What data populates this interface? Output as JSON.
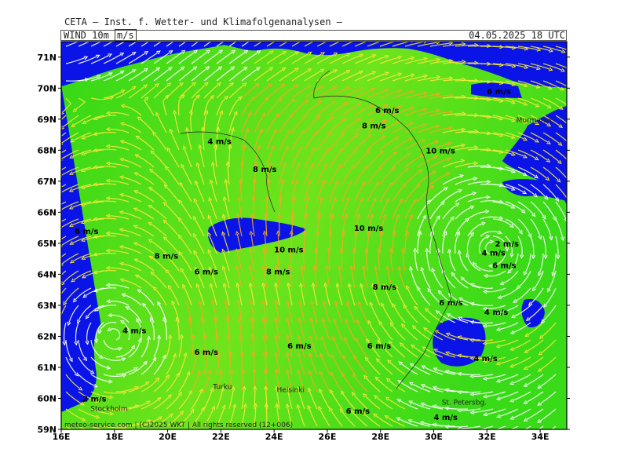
{
  "header": {
    "title": "CETA — Inst. f. Wetter- und Klimafolgenanalysen —",
    "parameter": "WIND  10m",
    "unit": "m/s",
    "datetime": "04.05.2025  18 UTC"
  },
  "map": {
    "lon_range": [
      16,
      35
    ],
    "lat_range": [
      59,
      71.5
    ],
    "lat_ticks": [
      "71N",
      "70N",
      "69N",
      "68N",
      "67N",
      "66N",
      "65N",
      "64N",
      "63N",
      "62N",
      "61N",
      "60N",
      "59N"
    ],
    "lon_ticks": [
      "16E",
      "18E",
      "20E",
      "22E",
      "24E",
      "26E",
      "28E",
      "30E",
      "32E",
      "34E"
    ],
    "colors": {
      "sea": "#0a14e6",
      "land_low": "#35dc1a",
      "land_high": "#7ee81e",
      "stream_calm": "#ffffff",
      "stream_mid": "#f7e93a",
      "stream_strong": "#f4a820"
    },
    "speed_labels": [
      {
        "text": "4 m/s",
        "lon": 21.5,
        "lat": 68.2
      },
      {
        "text": "6 m/s",
        "lon": 27.8,
        "lat": 69.2
      },
      {
        "text": "8 m/s",
        "lon": 27.3,
        "lat": 68.7
      },
      {
        "text": "10 m/s",
        "lon": 29.7,
        "lat": 67.9
      },
      {
        "text": "8 m/s",
        "lon": 23.2,
        "lat": 67.3
      },
      {
        "text": "6 m/s",
        "lon": 16.5,
        "lat": 65.3
      },
      {
        "text": "8 m/s",
        "lon": 19.5,
        "lat": 64.5
      },
      {
        "text": "6 m/s",
        "lon": 21.0,
        "lat": 64.0
      },
      {
        "text": "10 m/s",
        "lon": 24.0,
        "lat": 64.7
      },
      {
        "text": "8 m/s",
        "lon": 23.7,
        "lat": 64.0
      },
      {
        "text": "10 m/s",
        "lon": 27.0,
        "lat": 65.4
      },
      {
        "text": "8 m/s",
        "lon": 27.7,
        "lat": 63.5
      },
      {
        "text": "2 m/s",
        "lon": 32.3,
        "lat": 64.9
      },
      {
        "text": "4 m/s",
        "lon": 31.8,
        "lat": 64.6
      },
      {
        "text": "6 m/s",
        "lon": 32.2,
        "lat": 64.2
      },
      {
        "text": "6 m/s",
        "lon": 30.2,
        "lat": 63.0
      },
      {
        "text": "4 m/s",
        "lon": 31.9,
        "lat": 62.7
      },
      {
        "text": "4 m/s",
        "lon": 18.3,
        "lat": 62.1
      },
      {
        "text": "6 m/s",
        "lon": 24.5,
        "lat": 61.6
      },
      {
        "text": "6 m/s",
        "lon": 27.5,
        "lat": 61.6
      },
      {
        "text": "6 m/s",
        "lon": 21.0,
        "lat": 61.4
      },
      {
        "text": "4 m/s",
        "lon": 31.5,
        "lat": 61.2
      },
      {
        "text": "2 m/s",
        "lon": 16.8,
        "lat": 59.9
      },
      {
        "text": "6 m/s",
        "lon": 26.7,
        "lat": 59.5
      },
      {
        "text": "4 m/s",
        "lon": 30.0,
        "lat": 59.3
      },
      {
        "text": "6 m/s",
        "lon": 32.0,
        "lat": 69.8
      }
    ],
    "cities": [
      {
        "name": "Murmansk",
        "lon": 33.1,
        "lat": 68.9
      },
      {
        "name": "Helsinki",
        "lon": 24.1,
        "lat": 60.2
      },
      {
        "name": "Turku",
        "lon": 21.7,
        "lat": 60.3
      },
      {
        "name": "St. Petersbg.",
        "lon": 30.3,
        "lat": 59.8
      },
      {
        "name": "Stockholm",
        "lon": 17.1,
        "lat": 59.6
      }
    ],
    "footer": "meteo-service.com  |  (C)2025 WKT  |  All rights reserved  (12+006)"
  }
}
